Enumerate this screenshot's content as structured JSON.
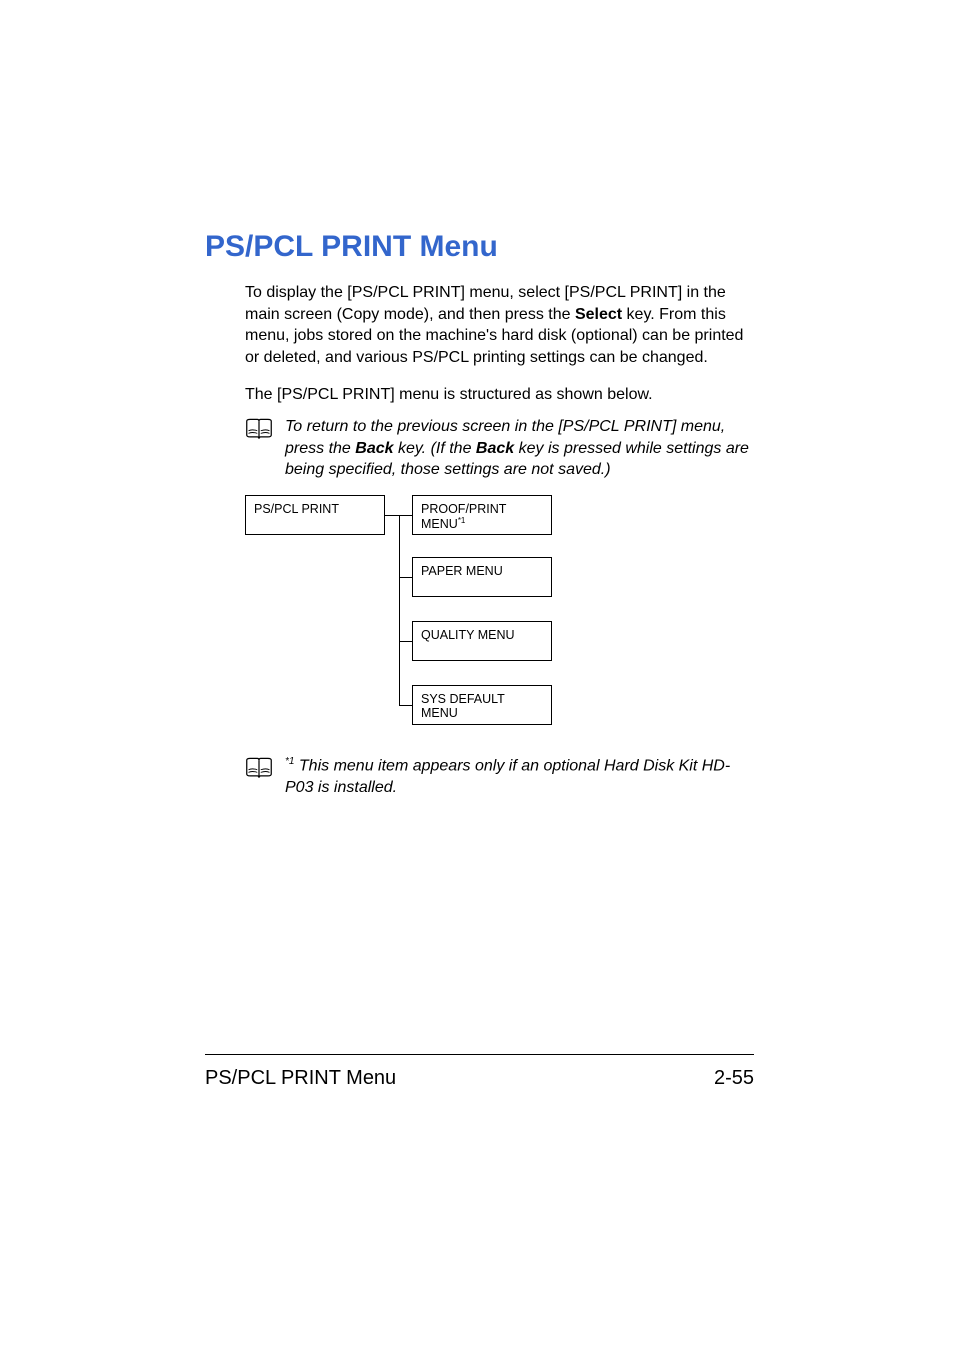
{
  "heading": "PS/PCL PRINT Menu",
  "para1_a": "To display the [PS/PCL PRINT] menu, select [PS/PCL PRINT] in the main screen (Copy mode), and then press the ",
  "para1_bold": "Select",
  "para1_b": " key. From this menu, jobs stored on the machine's hard disk (optional) can be printed or deleted, and various PS/PCL printing settings can be changed.",
  "para2": "The [PS/PCL PRINT] menu is structured as shown below.",
  "note1_a": "To return to the previous screen in the [PS/PCL PRINT] menu, press the ",
  "note1_bold1": "Back",
  "note1_b": " key. (If the ",
  "note1_bold2": "Back",
  "note1_c": " key is pressed while settings are being specified, those settings are not saved.)",
  "diagram": {
    "root": "PS/PCL PRINT",
    "child1": "PROOF/PRINT MENU",
    "child1_sup": "*1",
    "child2": "PAPER MENU",
    "child3": "QUALITY MENU",
    "child4": "SYS DEFAULT MENU"
  },
  "note2_sup": "*1",
  "note2_text": " This menu item appears only if an optional Hard Disk Kit HD-P03 is installed.",
  "footer_left": "PS/PCL PRINT Menu",
  "footer_right": "2-55"
}
